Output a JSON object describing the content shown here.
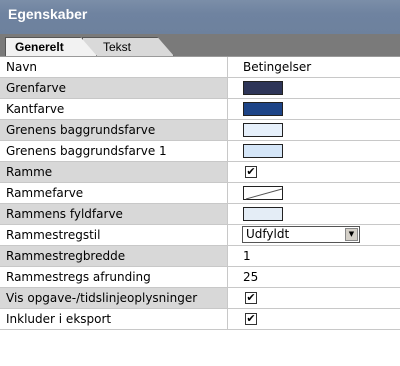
{
  "panel": {
    "title": "Egenskaber"
  },
  "tabs": [
    {
      "label": "Generelt",
      "active": true
    },
    {
      "label": "Tekst",
      "active": false
    }
  ],
  "rows": [
    {
      "label": "Navn",
      "type": "text",
      "value": "Betingelser"
    },
    {
      "label": "Grenfarve",
      "type": "color",
      "color": "#2e3558"
    },
    {
      "label": "Kantfarve",
      "type": "color",
      "color": "#1d4487"
    },
    {
      "label": "Grenens baggrundsfarve",
      "type": "color",
      "color": "#e6f0fb"
    },
    {
      "label": "Grenens baggrundsfarve 1",
      "type": "color",
      "color": "#d5e6f8"
    },
    {
      "label": "Ramme",
      "type": "checkbox",
      "checked": true
    },
    {
      "label": "Rammefarve",
      "type": "nocolor"
    },
    {
      "label": "Rammens fyldfarve",
      "type": "color",
      "color": "#e4edf6"
    },
    {
      "label": "Rammestregstil",
      "type": "dropdown",
      "value": "Udfyldt"
    },
    {
      "label": "Rammestregbredde",
      "type": "text",
      "value": "1"
    },
    {
      "label": "Rammestregs afrunding",
      "type": "text",
      "value": "25"
    },
    {
      "label": "Vis opgave-/tidslinjeoplysninger",
      "type": "checkbox",
      "checked": true
    },
    {
      "label": "Inkluder i eksport",
      "type": "checkbox",
      "checked": true
    }
  ],
  "icons": {
    "check": "✔",
    "dropdown_arrow": "▼"
  }
}
